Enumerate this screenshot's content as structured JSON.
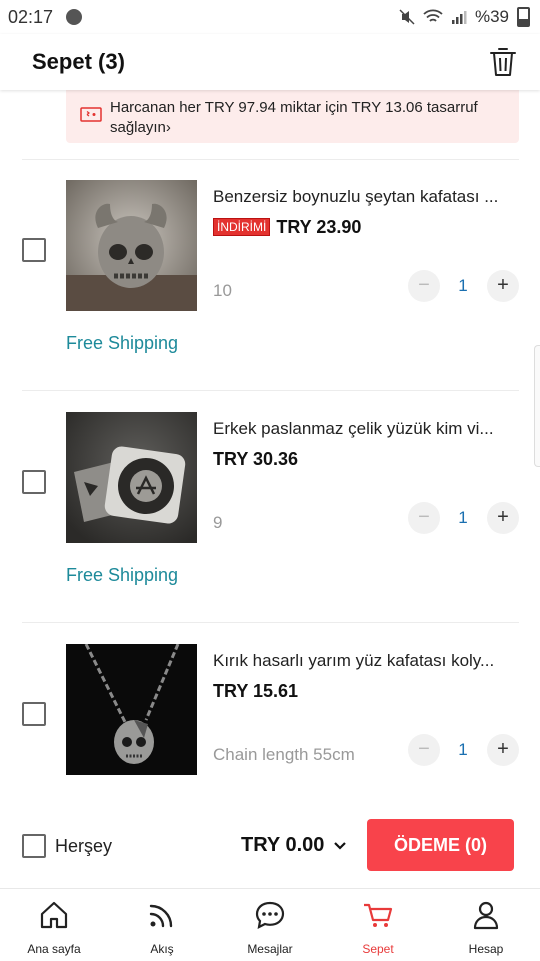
{
  "status": {
    "time": "02:17",
    "battery": "%39"
  },
  "header": {
    "title": "Sepet (3)"
  },
  "banner": {
    "text": "Harcanan her TRY 97.94 miktar için TRY 13.06 tasarruf sağlayın",
    "arrow": "›"
  },
  "items": [
    {
      "title": "Benzersiz boynuzlu şeytan kafatası ...",
      "badge": "İNDİRİMİ",
      "price": "TRY 23.90",
      "variant": "10",
      "qty": "1",
      "shipping": "Free Shipping",
      "minus": "−",
      "plus": "+"
    },
    {
      "title": "Erkek paslanmaz çelik yüzük kim vi...",
      "price": "TRY 30.36",
      "variant": "9",
      "qty": "1",
      "shipping": "Free Shipping",
      "minus": "−",
      "plus": "+"
    },
    {
      "title": "Kırık hasarlı yarım yüz kafatası koly...",
      "price": "TRY 15.61",
      "variant": "Chain length 55cm",
      "qty": "1",
      "minus": "−",
      "plus": "+"
    }
  ],
  "footer": {
    "select_all": "Herşey",
    "total": "TRY 0.00",
    "pay_button": "ÖDEME (0)"
  },
  "nav": [
    {
      "label": "Ana sayfa",
      "icon": "home-icon"
    },
    {
      "label": "Akış",
      "icon": "feed-icon"
    },
    {
      "label": "Mesajlar",
      "icon": "chat-icon"
    },
    {
      "label": "Sepet",
      "icon": "cart-icon",
      "active": true
    },
    {
      "label": "Hesap",
      "icon": "account-icon"
    }
  ],
  "colors": {
    "accent": "#f8434b",
    "nav_active": "#e83a3a",
    "shipping": "#1d8a9a",
    "banner_bg": "#fdeceb"
  }
}
